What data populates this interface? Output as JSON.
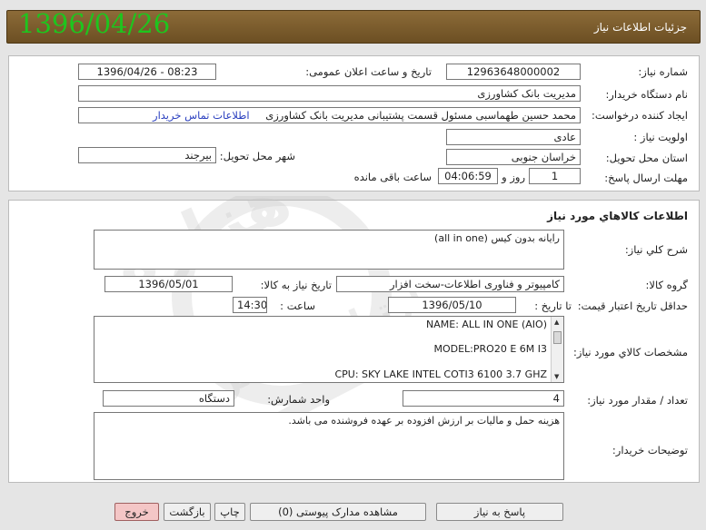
{
  "header": {
    "date": "1396/04/26",
    "title": "جزئیات اطلاعات نیاز"
  },
  "info": {
    "need_number_label": "شماره نیاز:",
    "need_number": "12963648000002",
    "announce_label": "تاریخ و ساعت اعلان عمومی:",
    "announce_value": "1396/04/26 - 08:23",
    "buyer_org_label": "نام دستگاه خریدار:",
    "buyer_org": "مدیریت بانک کشاورزی",
    "creator_label": "ایجاد کننده درخواست:",
    "creator": "محمد حسین  طهماسبی مسئول قسمت پشتیبانی مدیریت بانک کشاورزی",
    "contact_link": "اطلاعات تماس خریدار",
    "priority_label": "اولویت نیاز :",
    "priority": "عادی",
    "province_label": "استان محل تحویل:",
    "province": "خراسان جنوبی",
    "city_label": "شهر محل تحویل:",
    "city": "بیرجند",
    "deadline_label": "مهلت ارسال پاسخ:",
    "deadline_days": "1",
    "days_word": "روز و",
    "deadline_time": "04:06:59",
    "remaining_label": "ساعت باقی مانده"
  },
  "goods": {
    "section_title": "اطلاعات کالاهاي مورد نياز",
    "desc_label": "شرح کلي نياز:",
    "desc": "رایانه بدون کیس (all in one)",
    "group_label": "گروه کالا:",
    "group": "کامپیوتر و فناوری اطلاعات-سخت افزار",
    "need_date_label": "تاریخ نیاز به کالا:",
    "need_date": "1396/05/01",
    "min_validity_label": "حداقل تاریخ اعتبار قیمت:",
    "to_date_label": "تا تاریخ :",
    "to_date": "1396/05/10",
    "hour_label": "ساعت :",
    "hour": "14:30",
    "spec_label": "مشخصات کالاي مورد نياز:",
    "spec_lines": [
      "NAME: ALL IN ONE (AIO)",
      "MODEL:PRO20 E 6M I3",
      "CPU:  SKY LAKE INTEL COTI3 6100 3.7 GHZ"
    ],
    "qty_label": "تعداد / مقدار مورد نیاز:",
    "qty": "4",
    "unit_label": "واحد شمارش:",
    "unit": "دستگاه",
    "buyer_notes_label": "توضیحات خریدار:",
    "buyer_notes": "هزینه حمل و مالیات بر ارزش افزوده بر عهده فروشنده می باشد."
  },
  "footer": {
    "reply": "پاسخ به نیاز",
    "attachments": "مشاهده مدارک پیوستی (0)",
    "print": "چاپ",
    "back": "بازگشت",
    "exit": "خروج"
  },
  "watermark": {
    "text1": "هزاره",
    "text2": "ارتباط گستر"
  },
  "colors": {
    "title_bg": "#7a5a2a",
    "date_green": "#1ec51e",
    "link_blue": "#2a3fbf",
    "exit_red": "#f4c6c6"
  }
}
